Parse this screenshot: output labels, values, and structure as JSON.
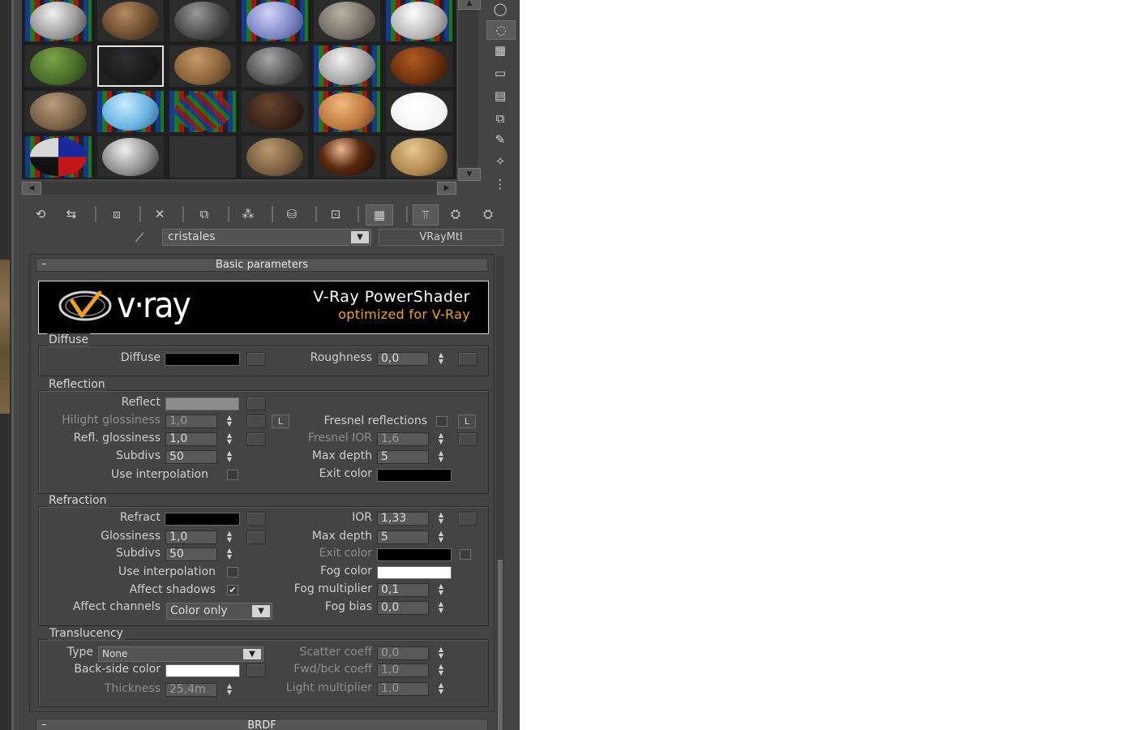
{
  "material": {
    "name": "cristales",
    "type": "VRayMtl"
  },
  "rollouts": {
    "basic": {
      "toggle": "–",
      "title": "Basic parameters"
    },
    "brdf": {
      "toggle": "–",
      "title": "BRDF"
    }
  },
  "banner": {
    "logo": "v·ray",
    "line1": "V-Ray PowerShader",
    "line2": "optimized for V-Ray"
  },
  "diffuse": {
    "group": "Diffuse",
    "diffuse_label": "Diffuse",
    "diffuse_color": "#000000",
    "roughness_label": "Roughness",
    "roughness_value": "0,0"
  },
  "reflection": {
    "group": "Reflection",
    "reflect_label": "Reflect",
    "reflect_color": "#8c8c8c",
    "hilight_label": "Hilight glossiness",
    "hilight_value": "1,0",
    "lock_label": "L",
    "fresnel_label": "Fresnel reflections",
    "fresnel_lock": "L",
    "refl_gloss_label": "Refl. glossiness",
    "refl_gloss_value": "1,0",
    "fresnel_ior_label": "Fresnel IOR",
    "fresnel_ior_value": "1,6",
    "subdivs_label": "Subdivs",
    "subdivs_value": "50",
    "max_depth_label": "Max depth",
    "max_depth_value": "5",
    "use_interp_label": "Use interpolation",
    "exit_color_label": "Exit color",
    "exit_color": "#000000"
  },
  "refraction": {
    "group": "Refraction",
    "refract_label": "Refract",
    "refract_color": "#000000",
    "ior_label": "IOR",
    "ior_value": "1,33",
    "gloss_label": "Glossiness",
    "gloss_value": "1,0",
    "max_depth_label": "Max depth",
    "max_depth_value": "5",
    "subdivs_label": "Subdivs",
    "subdivs_value": "50",
    "exit_color_label": "Exit color",
    "exit_color": "#000000",
    "use_interp_label": "Use interpolation",
    "fog_color_label": "Fog color",
    "fog_color": "#ffffff",
    "affect_shadows_label": "Affect shadows",
    "affect_shadows_checked": "✔",
    "fog_mult_label": "Fog multiplier",
    "fog_mult_value": "0,1",
    "affect_channels_label": "Affect channels",
    "affect_channels_value": "Color only",
    "fog_bias_label": "Fog bias",
    "fog_bias_value": "0,0"
  },
  "translucency": {
    "group": "Translucency",
    "type_label": "Type",
    "type_value": "None",
    "scatter_label": "Scatter coeff",
    "scatter_value": "0,0",
    "backside_label": "Back-side color",
    "backside_color": "#ffffff",
    "fwdbck_label": "Fwd/bck coeff",
    "fwdbck_value": "1,0",
    "thickness_label": "Thickness",
    "thickness_value": "25,4m",
    "light_mult_label": "Light multiplier",
    "light_mult_value": "1,0"
  },
  "icons": {
    "down_arrow": "▼",
    "spin_up": "▲",
    "spin_down": "▼",
    "scroll_up": "▲",
    "scroll_down": "▼",
    "scroll_left": "◀",
    "scroll_right": "▶",
    "eyedropper": "⟋"
  }
}
